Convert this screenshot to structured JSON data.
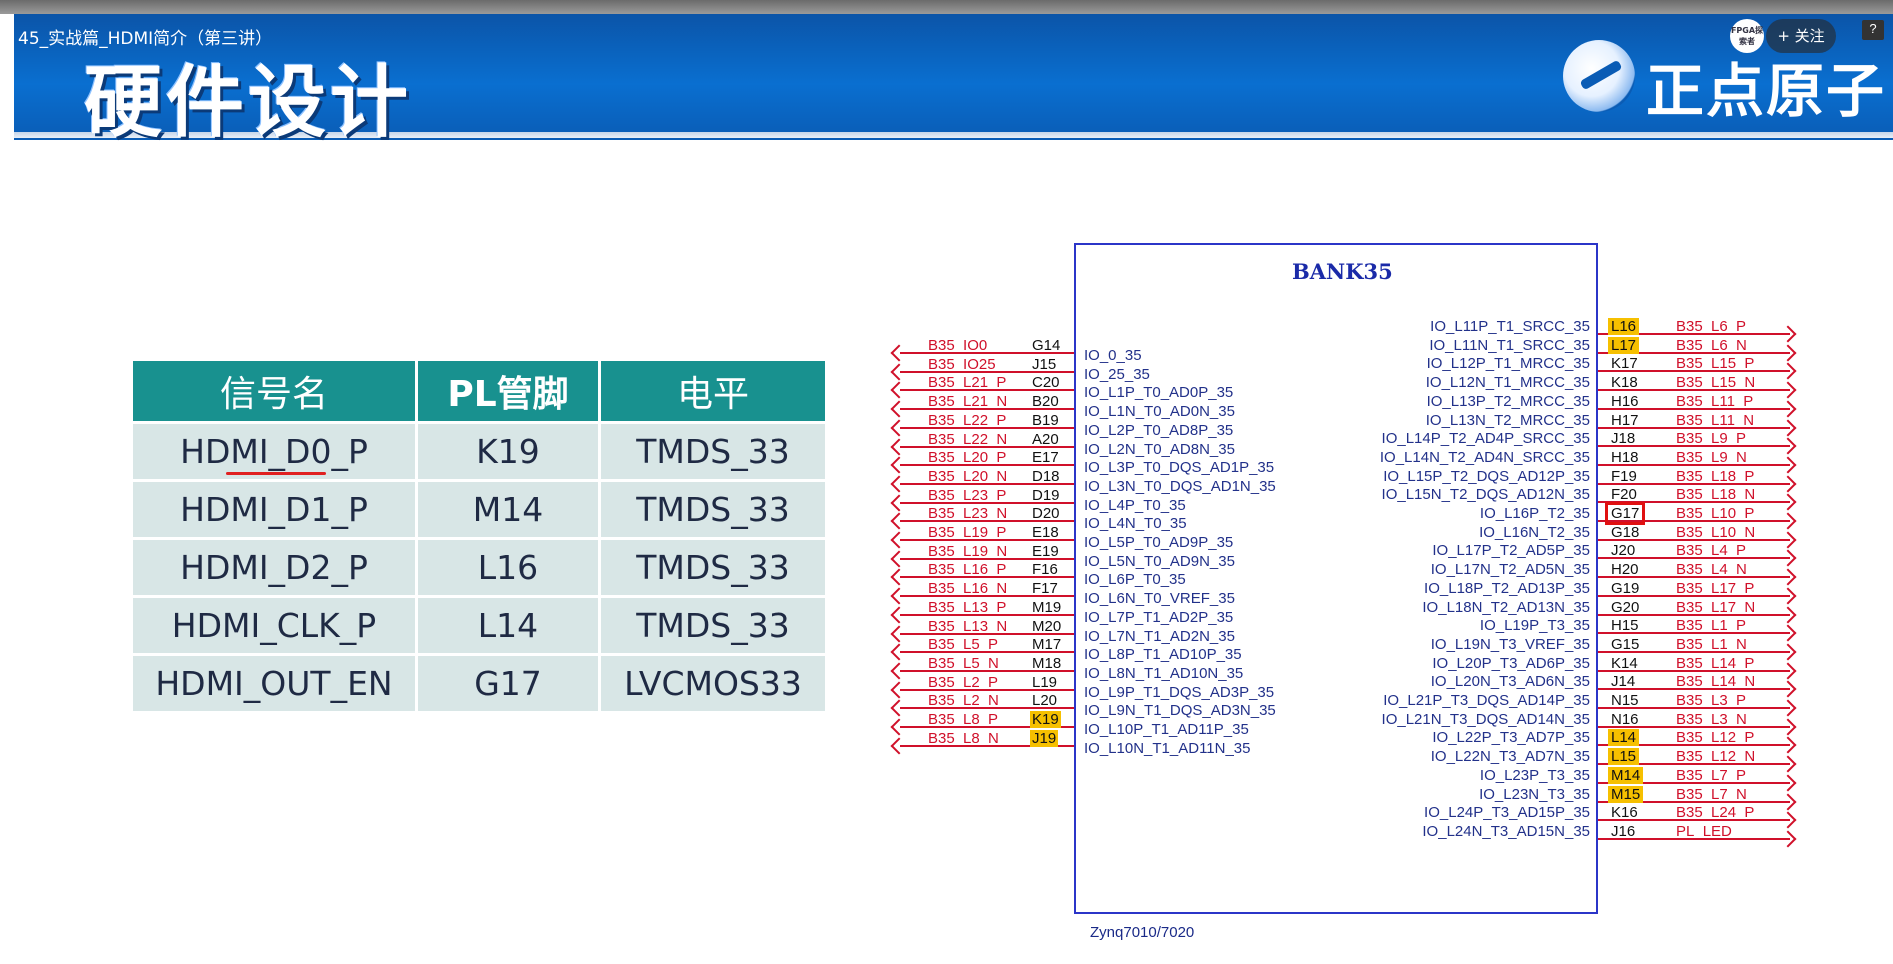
{
  "header": {
    "video_title": "45_实战篇_HDMI简介（第三讲）",
    "slide_title": "硬件设计",
    "brand": "正点原子",
    "fpga_badge": "FPGA探索者",
    "follow_label": "+ 关注",
    "help_icon": "?"
  },
  "table": {
    "headers": [
      "信号名",
      "PL管脚",
      "电平"
    ],
    "rows": [
      [
        "HDMI_D0_P",
        "K19",
        "TMDS_33"
      ],
      [
        "HDMI_D1_P",
        "M14",
        "TMDS_33"
      ],
      [
        "HDMI_D2_P",
        "L16",
        "TMDS_33"
      ],
      [
        "HDMI_CLK_P",
        "L14",
        "TMDS_33"
      ],
      [
        "HDMI_OUT_EN",
        "G17",
        "LVCMOS33"
      ]
    ]
  },
  "schematic": {
    "bank_title": "BANK35",
    "chip_label": "Zynq7010/7020",
    "left_pins": [
      {
        "net": "B35_IO0",
        "pin": "G14",
        "io": "IO_0_35",
        "hl": false
      },
      {
        "net": "B35_IO25",
        "pin": "J15",
        "io": "IO_25_35",
        "hl": false
      },
      {
        "net": "B35_L21_P",
        "pin": "C20",
        "io": "IO_L1P_T0_AD0P_35",
        "hl": false
      },
      {
        "net": "B35_L21_N",
        "pin": "B20",
        "io": "IO_L1N_T0_AD0N_35",
        "hl": false
      },
      {
        "net": "B35_L22_P",
        "pin": "B19",
        "io": "IO_L2P_T0_AD8P_35",
        "hl": false
      },
      {
        "net": "B35_L22_N",
        "pin": "A20",
        "io": "IO_L2N_T0_AD8N_35",
        "hl": false
      },
      {
        "net": "B35_L20_P",
        "pin": "E17",
        "io": "IO_L3P_T0_DQS_AD1P_35",
        "hl": false
      },
      {
        "net": "B35_L20_N",
        "pin": "D18",
        "io": "IO_L3N_T0_DQS_AD1N_35",
        "hl": false
      },
      {
        "net": "B35_L23_P",
        "pin": "D19",
        "io": "IO_L4P_T0_35",
        "hl": false
      },
      {
        "net": "B35_L23_N",
        "pin": "D20",
        "io": "IO_L4N_T0_35",
        "hl": false
      },
      {
        "net": "B35_L19_P",
        "pin": "E18",
        "io": "IO_L5P_T0_AD9P_35",
        "hl": false
      },
      {
        "net": "B35_L19_N",
        "pin": "E19",
        "io": "IO_L5N_T0_AD9N_35",
        "hl": false
      },
      {
        "net": "B35_L16_P",
        "pin": "F16",
        "io": "IO_L6P_T0_35",
        "hl": false
      },
      {
        "net": "B35_L16_N",
        "pin": "F17",
        "io": "IO_L6N_T0_VREF_35",
        "hl": false
      },
      {
        "net": "B35_L13_P",
        "pin": "M19",
        "io": "IO_L7P_T1_AD2P_35",
        "hl": false
      },
      {
        "net": "B35_L13_N",
        "pin": "M20",
        "io": "IO_L7N_T1_AD2N_35",
        "hl": false
      },
      {
        "net": "B35_L5_P",
        "pin": "M17",
        "io": "IO_L8P_T1_AD10P_35",
        "hl": false
      },
      {
        "net": "B35_L5_N",
        "pin": "M18",
        "io": "IO_L8N_T1_AD10N_35",
        "hl": false
      },
      {
        "net": "B35_L2_P",
        "pin": "L19",
        "io": "IO_L9P_T1_DQS_AD3P_35",
        "hl": false
      },
      {
        "net": "B35_L2_N",
        "pin": "L20",
        "io": "IO_L9N_T1_DQS_AD3N_35",
        "hl": false
      },
      {
        "net": "B35_L8_P",
        "pin": "K19",
        "io": "IO_L10P_T1_AD11P_35",
        "hl": true
      },
      {
        "net": "B35_L8_N",
        "pin": "J19",
        "io": "IO_L10N_T1_AD11N_35",
        "hl": true
      }
    ],
    "right_pins": [
      {
        "io": "IO_L11P_T1_SRCC_35",
        "pin": "L16",
        "net": "B35_L6_P",
        "hl": true,
        "boxed": false
      },
      {
        "io": "IO_L11N_T1_SRCC_35",
        "pin": "L17",
        "net": "B35_L6_N",
        "hl": true,
        "boxed": false
      },
      {
        "io": "IO_L12P_T1_MRCC_35",
        "pin": "K17",
        "net": "B35_L15_P",
        "hl": false,
        "boxed": false
      },
      {
        "io": "IO_L12N_T1_MRCC_35",
        "pin": "K18",
        "net": "B35_L15_N",
        "hl": false,
        "boxed": false
      },
      {
        "io": "IO_L13P_T2_MRCC_35",
        "pin": "H16",
        "net": "B35_L11_P",
        "hl": false,
        "boxed": false
      },
      {
        "io": "IO_L13N_T2_MRCC_35",
        "pin": "H17",
        "net": "B35_L11_N",
        "hl": false,
        "boxed": false
      },
      {
        "io": "IO_L14P_T2_AD4P_SRCC_35",
        "pin": "J18",
        "net": "B35_L9_P",
        "hl": false,
        "boxed": false
      },
      {
        "io": "IO_L14N_T2_AD4N_SRCC_35",
        "pin": "H18",
        "net": "B35_L9_N",
        "hl": false,
        "boxed": false
      },
      {
        "io": "IO_L15P_T2_DQS_AD12P_35",
        "pin": "F19",
        "net": "B35_L18_P",
        "hl": false,
        "boxed": false
      },
      {
        "io": "IO_L15N_T2_DQS_AD12N_35",
        "pin": "F20",
        "net": "B35_L18_N",
        "hl": false,
        "boxed": false
      },
      {
        "io": "IO_L16P_T2_35",
        "pin": "G17",
        "net": "B35_L10_P",
        "hl": false,
        "boxed": true
      },
      {
        "io": "IO_L16N_T2_35",
        "pin": "G18",
        "net": "B35_L10_N",
        "hl": false,
        "boxed": false
      },
      {
        "io": "IO_L17P_T2_AD5P_35",
        "pin": "J20",
        "net": "B35_L4_P",
        "hl": false,
        "boxed": false
      },
      {
        "io": "IO_L17N_T2_AD5N_35",
        "pin": "H20",
        "net": "B35_L4_N",
        "hl": false,
        "boxed": false
      },
      {
        "io": "IO_L18P_T2_AD13P_35",
        "pin": "G19",
        "net": "B35_L17_P",
        "hl": false,
        "boxed": false
      },
      {
        "io": "IO_L18N_T2_AD13N_35",
        "pin": "G20",
        "net": "B35_L17_N",
        "hl": false,
        "boxed": false
      },
      {
        "io": "IO_L19P_T3_35",
        "pin": "H15",
        "net": "B35_L1_P",
        "hl": false,
        "boxed": false
      },
      {
        "io": "IO_L19N_T3_VREF_35",
        "pin": "G15",
        "net": "B35_L1_N",
        "hl": false,
        "boxed": false
      },
      {
        "io": "IO_L20P_T3_AD6P_35",
        "pin": "K14",
        "net": "B35_L14_P",
        "hl": false,
        "boxed": false
      },
      {
        "io": "IO_L20N_T3_AD6N_35",
        "pin": "J14",
        "net": "B35_L14_N",
        "hl": false,
        "boxed": false
      },
      {
        "io": "IO_L21P_T3_DQS_AD14P_35",
        "pin": "N15",
        "net": "B35_L3_P",
        "hl": false,
        "boxed": false
      },
      {
        "io": "IO_L21N_T3_DQS_AD14N_35",
        "pin": "N16",
        "net": "B35_L3_N",
        "hl": false,
        "boxed": false
      },
      {
        "io": "IO_L22P_T3_AD7P_35",
        "pin": "L14",
        "net": "B35_L12_P",
        "hl": true,
        "boxed": false
      },
      {
        "io": "IO_L22N_T3_AD7N_35",
        "pin": "L15",
        "net": "B35_L12_N",
        "hl": true,
        "boxed": false
      },
      {
        "io": "IO_L23P_T3_35",
        "pin": "M14",
        "net": "B35_L7_P",
        "hl": true,
        "boxed": false
      },
      {
        "io": "IO_L23N_T3_35",
        "pin": "M15",
        "net": "B35_L7_N",
        "hl": true,
        "boxed": false
      },
      {
        "io": "IO_L24P_T3_AD15P_35",
        "pin": "K16",
        "net": "B35_L24_P",
        "hl": false,
        "boxed": false
      },
      {
        "io": "IO_L24N_T3_AD15N_35",
        "pin": "J16",
        "net": "PL_LED",
        "hl": false,
        "boxed": false
      }
    ]
  },
  "colors": {
    "header_blue": "#0a6fd0",
    "table_header": "#18918f",
    "table_cell": "#d8e6e6",
    "net_red": "#d0102a",
    "io_blue": "#22318a",
    "highlight_yellow": "#f6c000"
  }
}
